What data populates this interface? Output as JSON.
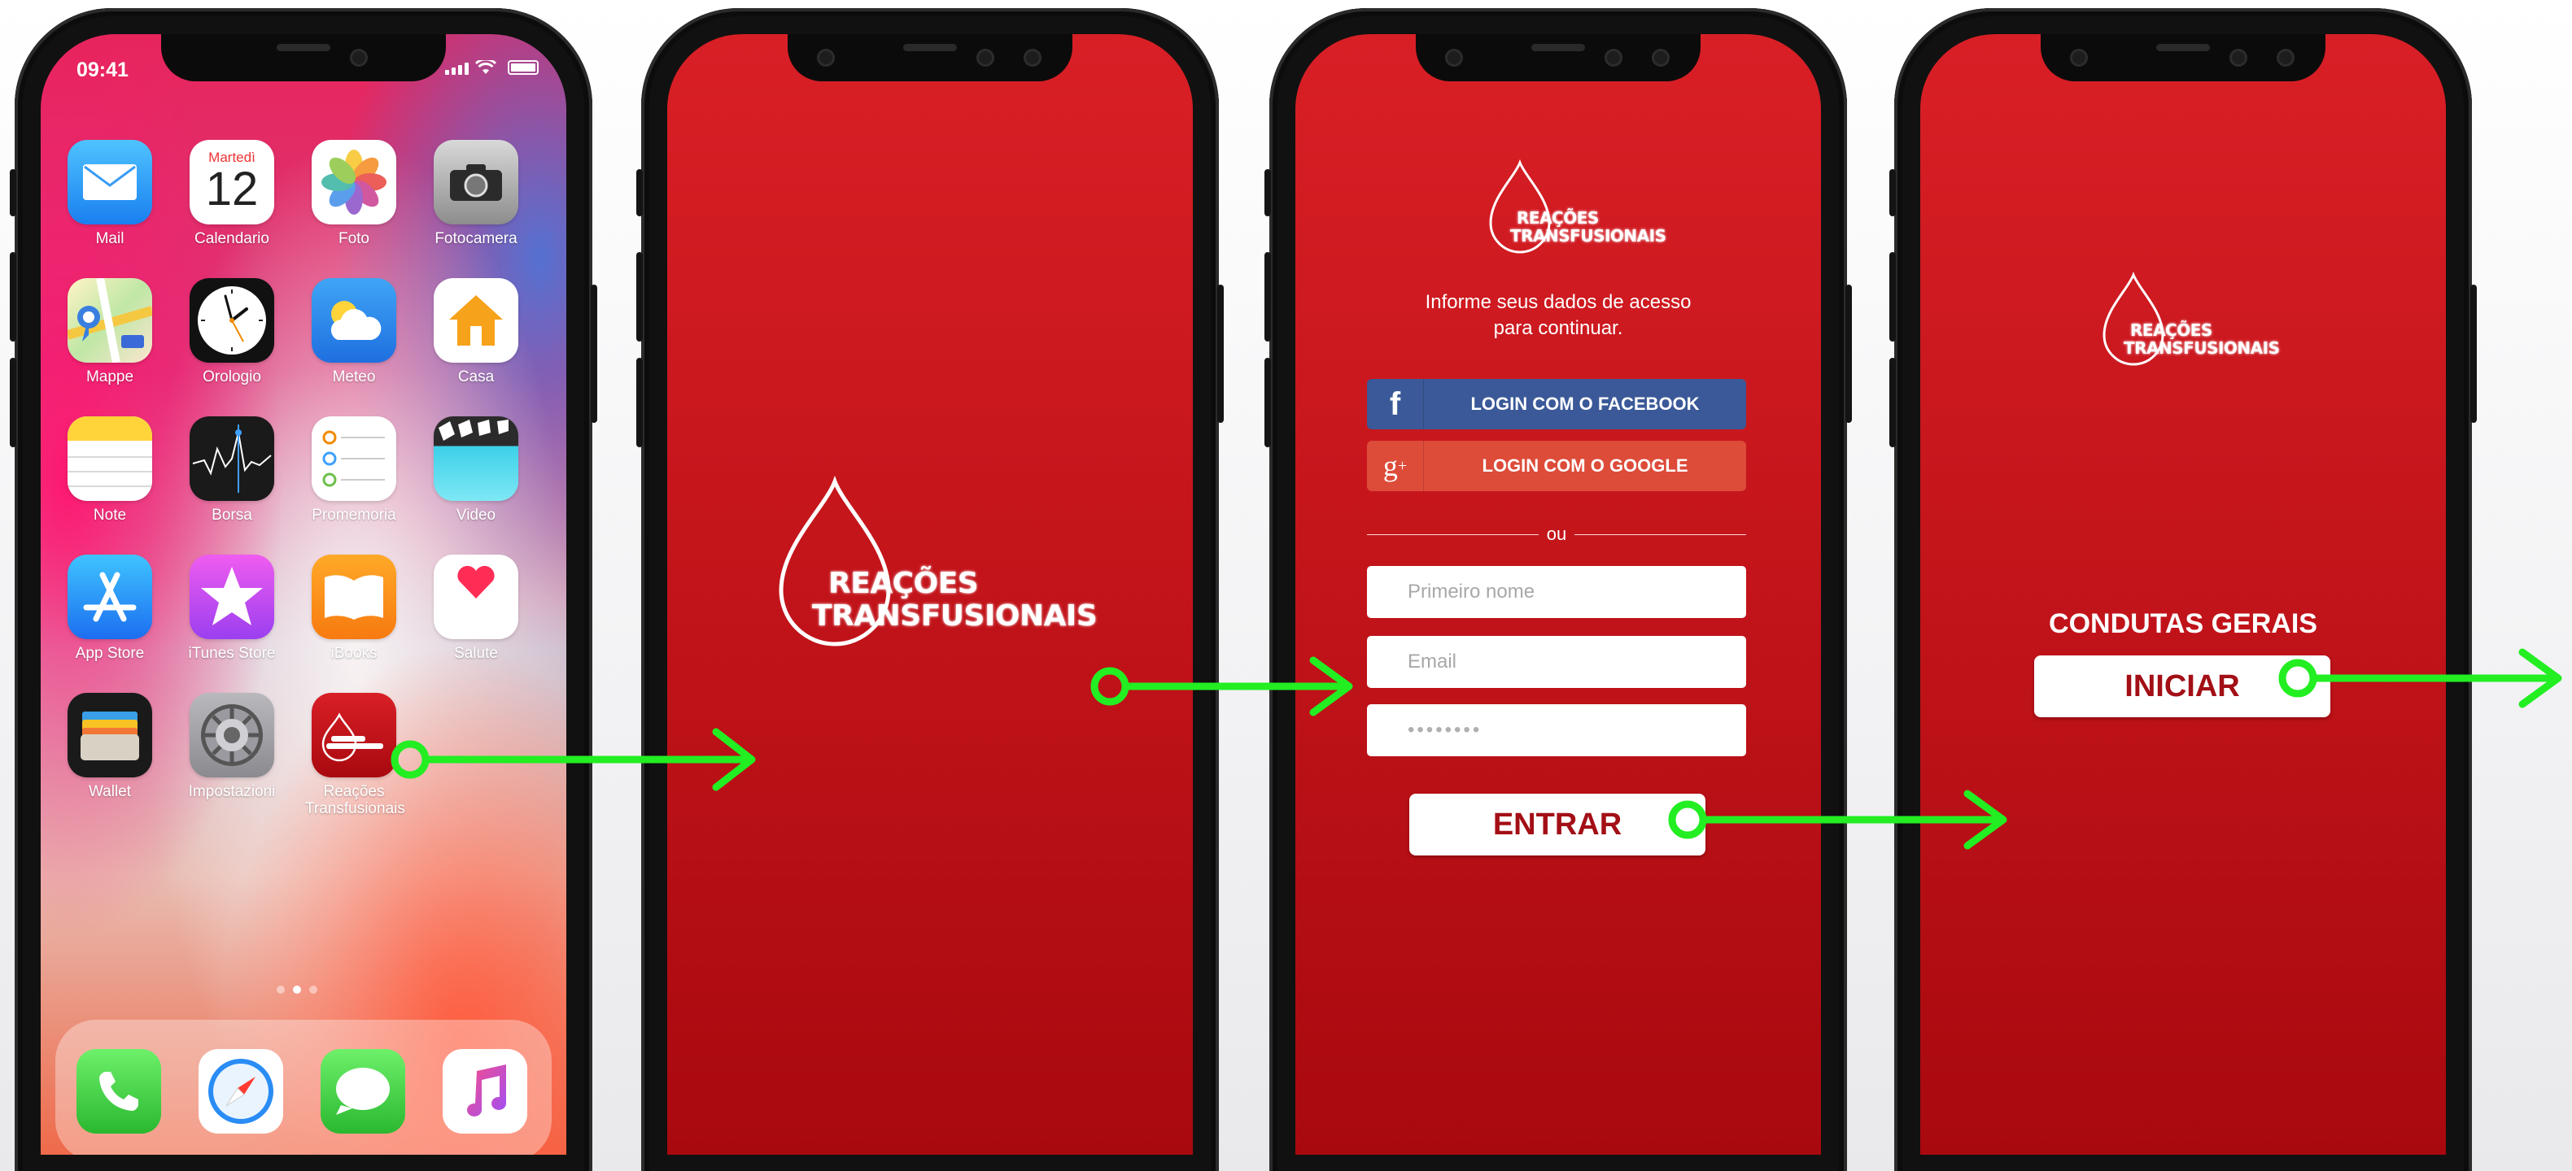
{
  "home": {
    "status_time": "09:41",
    "apps": [
      {
        "name": "Mail",
        "icon": "mail-icon"
      },
      {
        "name": "Calendario",
        "icon": "calendar-icon",
        "weekday": "Martedì",
        "day": "12"
      },
      {
        "name": "Foto",
        "icon": "photos-icon"
      },
      {
        "name": "Fotocamera",
        "icon": "camera-icon"
      },
      {
        "name": "Mappe",
        "icon": "maps-icon"
      },
      {
        "name": "Orologio",
        "icon": "clock-icon"
      },
      {
        "name": "Meteo",
        "icon": "weather-icon"
      },
      {
        "name": "Casa",
        "icon": "home-icon"
      },
      {
        "name": "Note",
        "icon": "notes-icon"
      },
      {
        "name": "Borsa",
        "icon": "stocks-icon"
      },
      {
        "name": "Promemoria",
        "icon": "reminders-icon"
      },
      {
        "name": "Video",
        "icon": "video-icon"
      },
      {
        "name": "App Store",
        "icon": "app-store-icon"
      },
      {
        "name": "iTunes Store",
        "icon": "itunes-store-icon"
      },
      {
        "name": "iBooks",
        "icon": "ibooks-icon"
      },
      {
        "name": "Salute",
        "icon": "health-icon"
      },
      {
        "name": "Wallet",
        "icon": "wallet-icon"
      },
      {
        "name": "Impostazioni",
        "icon": "settings-icon"
      },
      {
        "name": "Reações Transfusionais",
        "icon": "reacoes-transfusionais-icon"
      }
    ],
    "dock": [
      "phone-icon",
      "safari-icon",
      "messages-icon",
      "music-icon"
    ]
  },
  "logo": {
    "line1": "REAÇÕES",
    "line2": "TRANSFUSIONAIS"
  },
  "login": {
    "info_line1": "Informe seus dados de acesso",
    "info_line2": "para continuar.",
    "facebook_label": "LOGIN COM O FACEBOOK",
    "google_label": "LOGIN COM O GOOGLE",
    "divider": "ou",
    "first_name_placeholder": "Primeiro nome",
    "email_placeholder": "Email",
    "password_value": "••••••••",
    "submit_label": "ENTRAR"
  },
  "start": {
    "title": "CONDUTAS GERAIS",
    "button_label": "INICIAR"
  },
  "colors": {
    "screen_red": "#c4151b",
    "facebook": "#3b5998",
    "google": "#dd4b39",
    "arrow_green": "#22ee22",
    "button_text": "#a30f16"
  }
}
